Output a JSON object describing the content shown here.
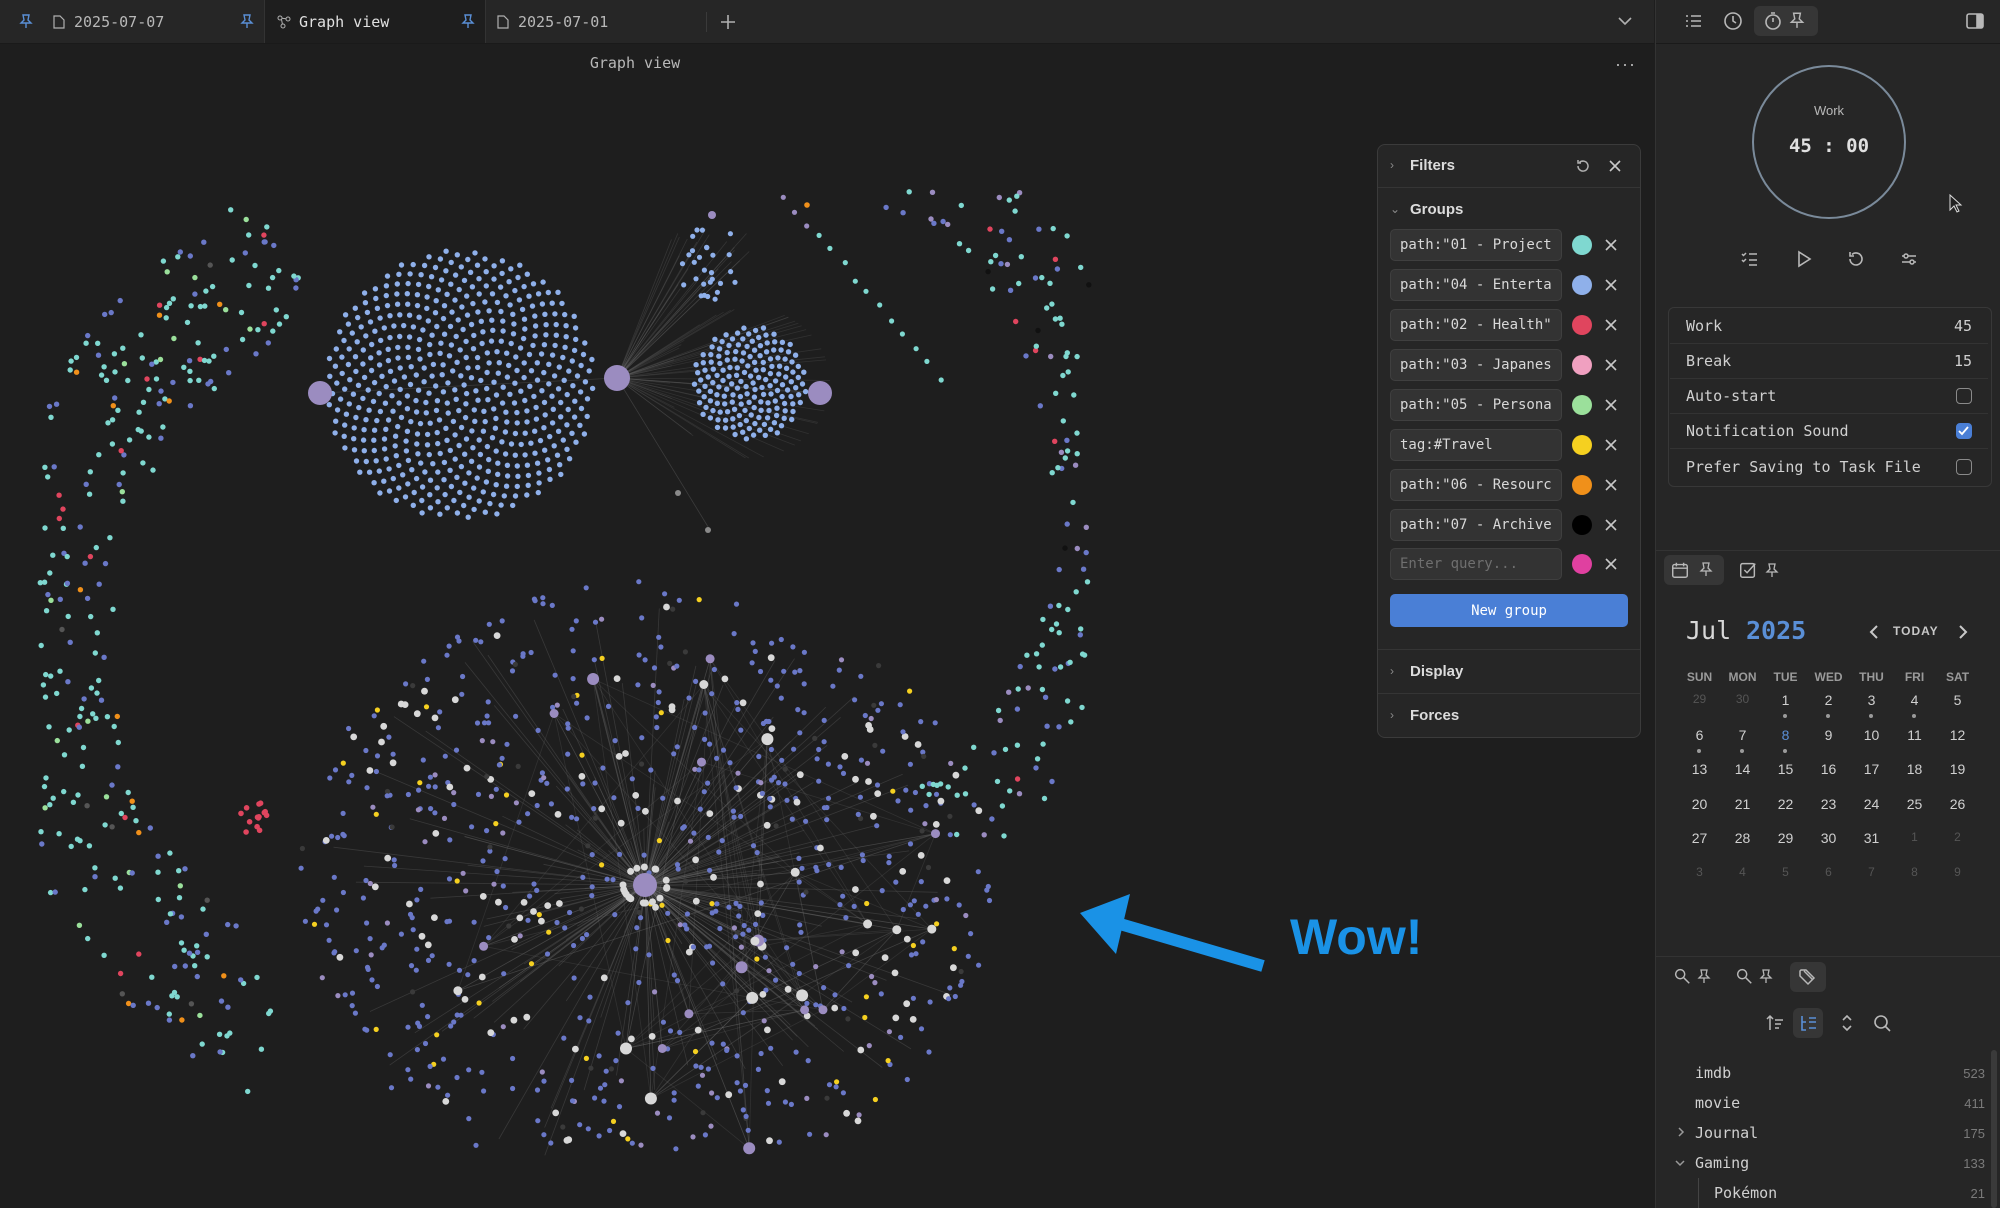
{
  "tabs": [
    {
      "label": "2025-07-07",
      "icon": "file-icon",
      "active": false
    },
    {
      "label": "Graph view",
      "icon": "graph-icon",
      "active": true
    },
    {
      "label": "2025-07-01",
      "icon": "file-icon",
      "active": false
    }
  ],
  "graph": {
    "title": "Graph view",
    "more": "···"
  },
  "filters": {
    "filters_label": "Filters",
    "groups_label": "Groups",
    "groups": [
      {
        "query": "path:\"01 - Project",
        "color": "#7fd8d0"
      },
      {
        "query": "path:\"04 - Enterta",
        "color": "#8fb0ea"
      },
      {
        "query": "path:\"02 - Health\"",
        "color": "#e0455e"
      },
      {
        "query": "path:\"03 - Japanes",
        "color": "#f0a0c0"
      },
      {
        "query": "path:\"05 - Persona",
        "color": "#9be09b"
      },
      {
        "query": "tag:#Travel",
        "color": "#f5d020"
      },
      {
        "query": "path:\"06 - Resourc",
        "color": "#f0901a"
      },
      {
        "query": "path:\"07 - Archive",
        "color": "#000000"
      }
    ],
    "new_query_placeholder": "Enter query...",
    "new_query_color": "#e040a0",
    "new_group_label": "New group",
    "display_label": "Display",
    "forces_label": "Forces"
  },
  "pomodoro": {
    "mode": "Work",
    "time": "45 : 00",
    "settings": [
      {
        "label": "Work",
        "value": "45"
      },
      {
        "label": "Break",
        "value": "15"
      },
      {
        "label": "Auto-start",
        "checked": false
      },
      {
        "label": "Notification Sound",
        "checked": true
      },
      {
        "label": "Prefer Saving to Task File",
        "checked": false
      }
    ]
  },
  "calendar": {
    "month": "Jul",
    "year": "2025",
    "today_label": "TODAY",
    "weekdays": [
      "SUN",
      "MON",
      "TUE",
      "WED",
      "THU",
      "FRI",
      "SAT"
    ],
    "weeks": [
      [
        "29",
        "30",
        "1",
        "2",
        "3",
        "4",
        "5"
      ],
      [
        "6",
        "7",
        "8",
        "9",
        "10",
        "11",
        "12"
      ],
      [
        "13",
        "14",
        "15",
        "16",
        "17",
        "18",
        "19"
      ],
      [
        "20",
        "21",
        "22",
        "23",
        "24",
        "25",
        "26"
      ],
      [
        "27",
        "28",
        "29",
        "30",
        "31",
        "1",
        "2"
      ],
      [
        "3",
        "4",
        "5",
        "6",
        "7",
        "8",
        "9"
      ]
    ]
  },
  "tags": [
    {
      "name": "imdb",
      "count": "523"
    },
    {
      "name": "movie",
      "count": "411"
    },
    {
      "name": "Journal",
      "count": "175",
      "collapsible": "collapsed"
    },
    {
      "name": "Gaming",
      "count": "133",
      "collapsible": "expanded"
    },
    {
      "name": "Pokémon",
      "count": "21",
      "child": true
    }
  ],
  "annotation": {
    "text": "Wow!",
    "color": "#1a92e6"
  }
}
